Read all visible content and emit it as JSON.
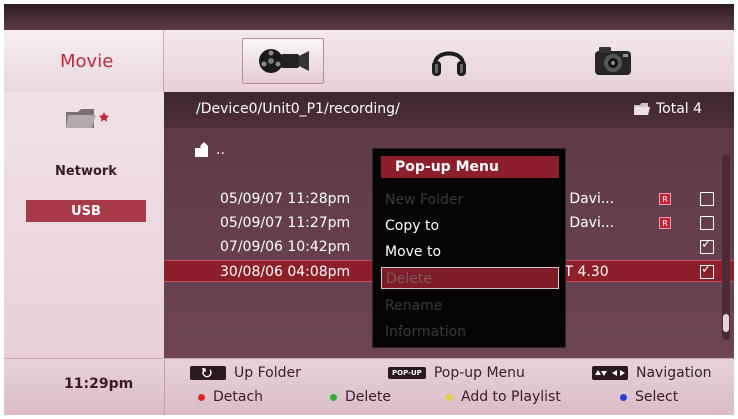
{
  "header": {
    "title": "Movie",
    "tabs": [
      {
        "icon": "film-reel-icon",
        "active": true
      },
      {
        "icon": "headphones-icon",
        "active": false
      },
      {
        "icon": "camera-icon",
        "active": false
      }
    ]
  },
  "sidebar": {
    "items": [
      {
        "label": "Network",
        "selected": false
      },
      {
        "label": "USB",
        "selected": true
      }
    ]
  },
  "pathbar": {
    "path": "/Device0/Unit0_P1/recording/",
    "total": "Total 4"
  },
  "list": {
    "up_label": "..",
    "rows": [
      {
        "date": "05/09/07 11:28pm",
        "name": "n Davi...",
        "rec": true,
        "checked": false,
        "highlight": false
      },
      {
        "date": "05/09/07 11:27pm",
        "name": "n Davi...",
        "rec": true,
        "checked": false,
        "highlight": false
      },
      {
        "date": "07/09/06 10:42pm",
        "name": "",
        "rec": false,
        "checked": true,
        "highlight": false
      },
      {
        "date": "30/08/06 04:08pm",
        "name": "AT 4.30",
        "rec": false,
        "checked": true,
        "highlight": true
      }
    ]
  },
  "popup": {
    "title": "Pop-up Menu",
    "items": [
      {
        "label": "New Folder",
        "state": "disabled"
      },
      {
        "label": "Copy to",
        "state": "enabled"
      },
      {
        "label": "Move to",
        "state": "enabled"
      },
      {
        "label": "Delete",
        "state": "selected"
      },
      {
        "label": "Rename",
        "state": "disabled"
      },
      {
        "label": "Information",
        "state": "disabled"
      }
    ]
  },
  "footer": {
    "time": "11:29pm",
    "up_folder": "Up Folder",
    "popup_menu": "Pop-up Menu",
    "popup_key": "POP-UP",
    "navigation": "Navigation",
    "detach": "Detach",
    "delete": "Delete",
    "add_to_playlist": "Add to Playlist",
    "select": "Select"
  },
  "colors": {
    "red": "#d42a2a",
    "green": "#2fae3a",
    "yellow": "#e2cf3a",
    "blue": "#2a3ed6",
    "accent": "#8c1f2a"
  }
}
